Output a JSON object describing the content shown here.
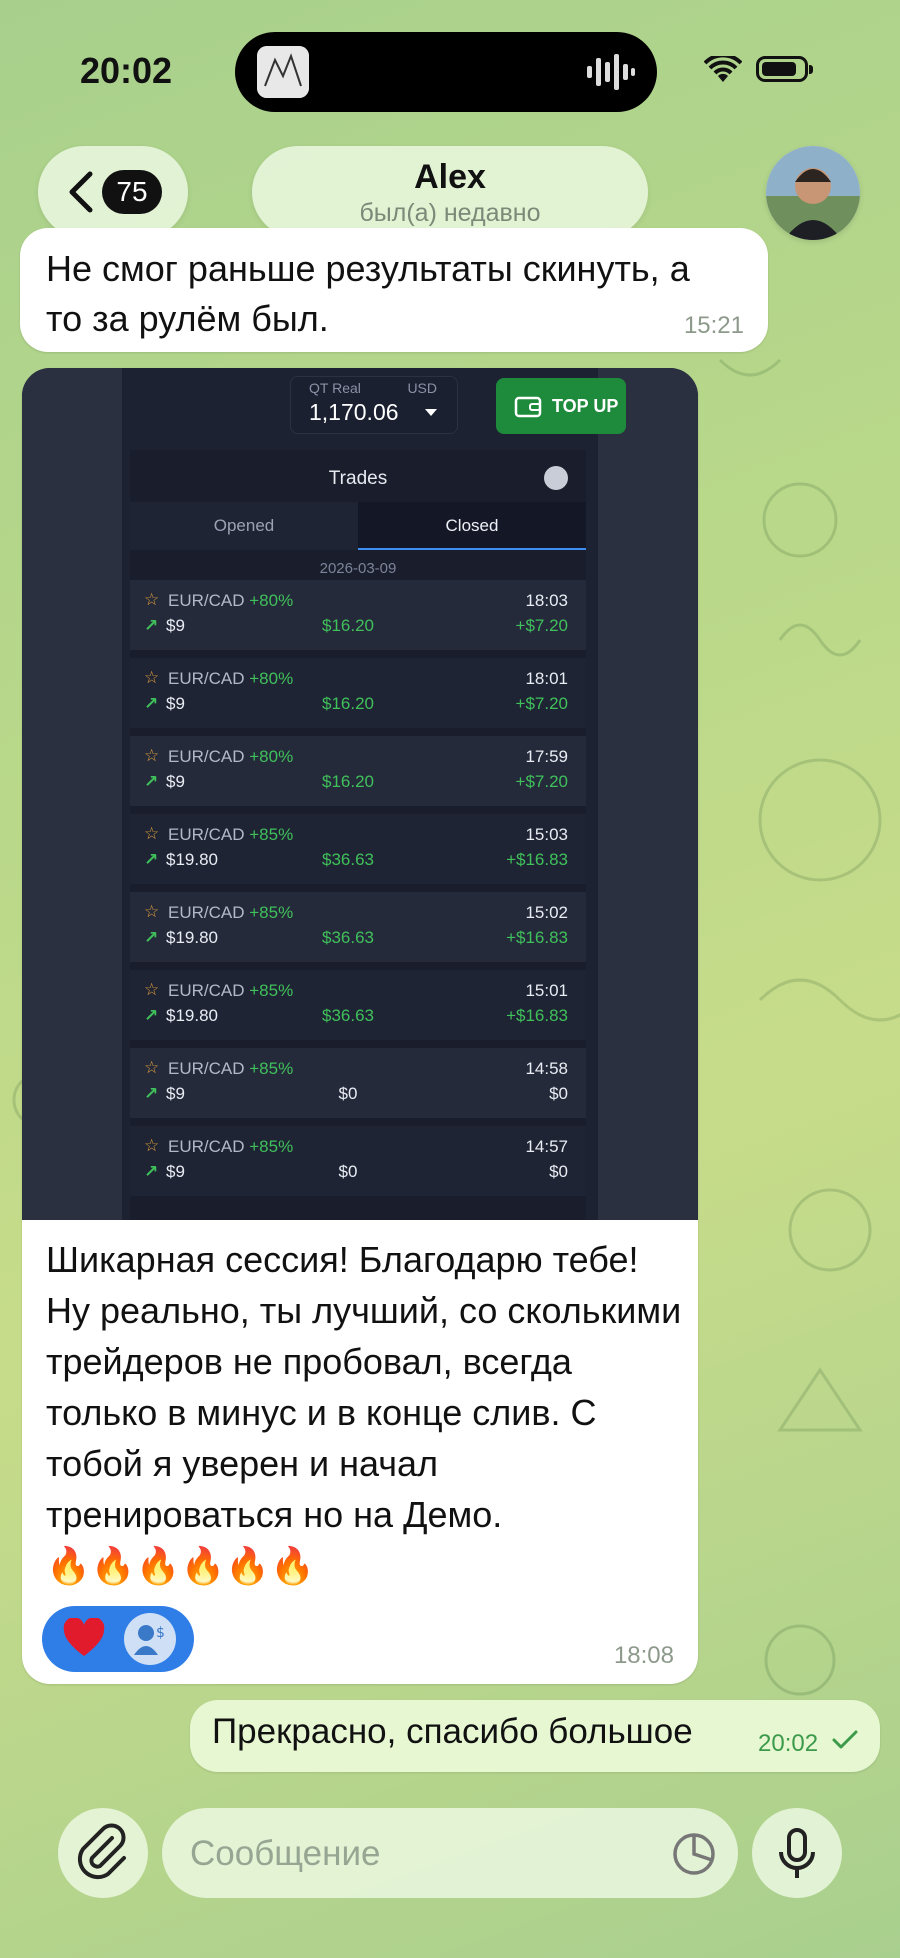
{
  "status_bar": {
    "time": "20:02"
  },
  "header": {
    "unread_count": "75",
    "contact_name": "Alex",
    "contact_status": "был(а) недавно"
  },
  "messages": [
    {
      "direction": "in",
      "text": "Не смог раньше результаты скинуть, а то за рулём  был.",
      "time": "15:21"
    },
    {
      "direction": "in",
      "text": "Шикарная сессия! Благодарю тебе! Ну реально, ты лучший, со сколькими трейдеров не пробовал, всегда только в минус и в конце слив. С тобой я уверен и начал тренироваться но на Демо.",
      "emoji": "🔥🔥🔥🔥🔥🔥",
      "time": "18:08",
      "reaction": "heart"
    },
    {
      "direction": "out",
      "text": "Прекрасно, спасибо большое",
      "time": "20:02",
      "status": "read"
    }
  ],
  "screenshot": {
    "account_label": "QT Real",
    "currency": "USD",
    "balance": "1,170.06",
    "topup_label": "TOP UP",
    "panel_title": "Trades",
    "tabs": [
      "Opened",
      "Closed"
    ],
    "active_tab": "Closed",
    "date": "2026-03-09",
    "trades": [
      {
        "pair": "EUR/CAD",
        "pct": "+80%",
        "time": "18:03",
        "investment": "$9",
        "payout": "$16.20",
        "profit": "+$7.20"
      },
      {
        "pair": "EUR/CAD",
        "pct": "+80%",
        "time": "18:01",
        "investment": "$9",
        "payout": "$16.20",
        "profit": "+$7.20"
      },
      {
        "pair": "EUR/CAD",
        "pct": "+80%",
        "time": "17:59",
        "investment": "$9",
        "payout": "$16.20",
        "profit": "+$7.20"
      },
      {
        "pair": "EUR/CAD",
        "pct": "+85%",
        "time": "15:03",
        "investment": "$19.80",
        "payout": "$36.63",
        "profit": "+$16.83"
      },
      {
        "pair": "EUR/CAD",
        "pct": "+85%",
        "time": "15:02",
        "investment": "$19.80",
        "payout": "$36.63",
        "profit": "+$16.83"
      },
      {
        "pair": "EUR/CAD",
        "pct": "+85%",
        "time": "15:01",
        "investment": "$19.80",
        "payout": "$36.63",
        "profit": "+$16.83"
      },
      {
        "pair": "EUR/CAD",
        "pct": "+85%",
        "time": "14:58",
        "investment": "$9",
        "payout": "$0",
        "profit": "$0"
      },
      {
        "pair": "EUR/CAD",
        "pct": "+85%",
        "time": "14:57",
        "investment": "$9",
        "payout": "$0",
        "profit": "$0"
      }
    ]
  },
  "composer": {
    "placeholder": "Сообщение"
  },
  "colors": {
    "accent_green": "#3fc05a",
    "reaction_blue": "#2f7ee8",
    "outgoing_bubble": "#e6f7d2",
    "read_check": "#3c9a4a"
  },
  "icons": [
    "back-chevron-icon",
    "wifi-icon",
    "battery-icon",
    "attach-icon",
    "sticker-icon",
    "mic-icon",
    "heart-icon",
    "star-icon",
    "arrow-up-right-icon",
    "wallet-icon",
    "check-icon"
  ]
}
